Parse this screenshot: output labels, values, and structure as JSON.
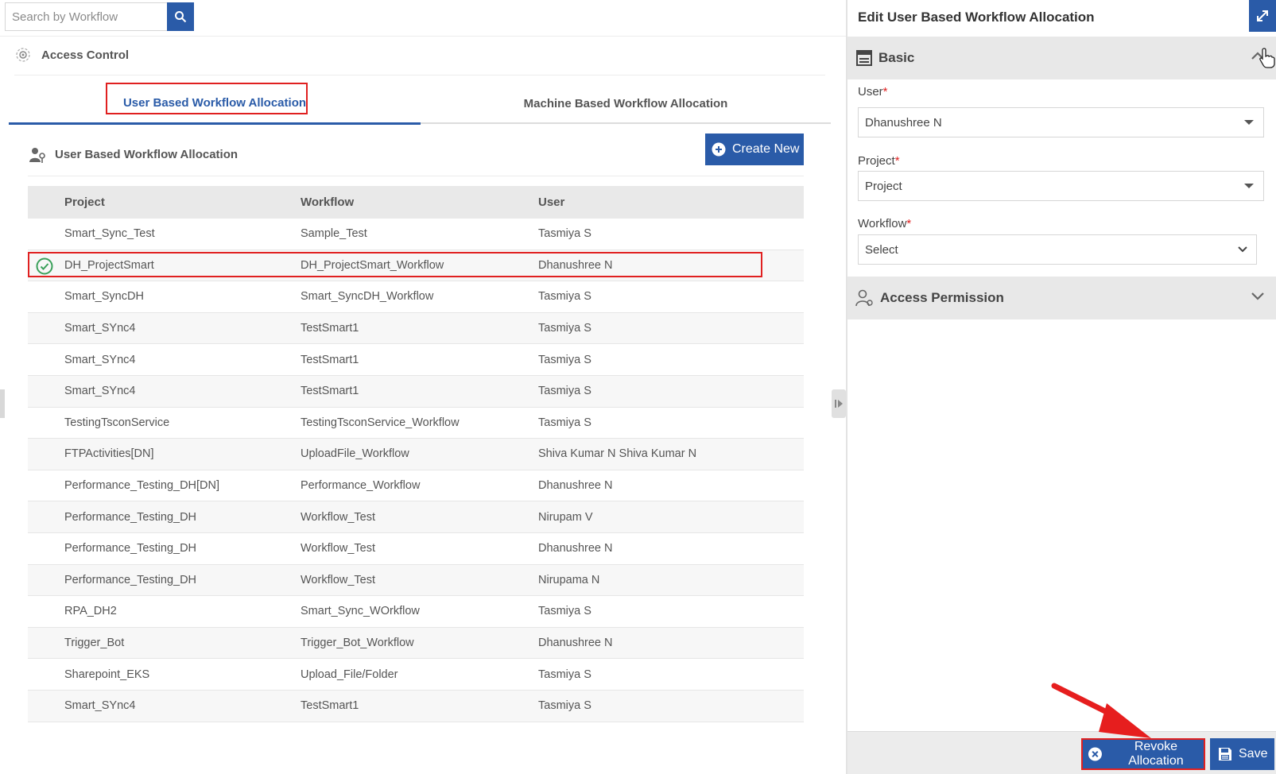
{
  "search": {
    "placeholder": "Search by Workflow"
  },
  "breadcrumb": {
    "label": "Access Control"
  },
  "tabs": [
    {
      "label": "User Based Workflow Allocation",
      "active": true
    },
    {
      "label": "Machine Based Workflow Allocation",
      "active": false
    }
  ],
  "section": {
    "title": "User Based Workflow Allocation",
    "create_label": "Create New"
  },
  "table": {
    "headers": [
      "Project",
      "Workflow",
      "User"
    ],
    "rows": [
      [
        "Smart_Sync_Test",
        "Sample_Test",
        "Tasmiya S"
      ],
      [
        "DH_ProjectSmart",
        "DH_ProjectSmart_Workflow",
        "Dhanushree N"
      ],
      [
        "Smart_SyncDH",
        "Smart_SyncDH_Workflow",
        "Tasmiya S"
      ],
      [
        "Smart_SYnc4",
        "TestSmart1",
        "Tasmiya S"
      ],
      [
        "Smart_SYnc4",
        "TestSmart1",
        "Tasmiya S"
      ],
      [
        "Smart_SYnc4",
        "TestSmart1",
        "Tasmiya S"
      ],
      [
        "TestingTsconService",
        "TestingTsconService_Workflow",
        "Tasmiya S"
      ],
      [
        "FTPActivities[DN]",
        "UploadFile_Workflow",
        "Shiva Kumar N Shiva Kumar N"
      ],
      [
        "Performance_Testing_DH[DN]",
        "Performance_Workflow",
        "Dhanushree N"
      ],
      [
        "Performance_Testing_DH",
        "Workflow_Test",
        "Nirupam V"
      ],
      [
        "Performance_Testing_DH",
        "Workflow_Test",
        "Dhanushree N"
      ],
      [
        "Performance_Testing_DH",
        "Workflow_Test",
        "Nirupama N"
      ],
      [
        "RPA_DH2",
        "Smart_Sync_WOrkflow",
        "Tasmiya S"
      ],
      [
        "Trigger_Bot",
        "Trigger_Bot_Workflow",
        "Dhanushree N"
      ],
      [
        "Sharepoint_EKS",
        "Upload_File/Folder",
        "Tasmiya S"
      ],
      [
        "Smart_SYnc4",
        "TestSmart1",
        "Tasmiya S"
      ]
    ],
    "selected_row": 1
  },
  "panel": {
    "title": "Edit User Based Workflow Allocation",
    "basic_label": "Basic",
    "user_label": "User",
    "user_value": "Dhanushree N",
    "project_label": "Project",
    "project_value": "Project",
    "workflow_label": "Workflow",
    "workflow_value": "Select",
    "required_mark": "*",
    "access_label": "Access Permission",
    "revoke_label": "Revoke Allocation",
    "save_label": "Save"
  },
  "colors": {
    "accent": "#2a5ba8",
    "highlight": "#e02020",
    "check": "#3aa05a"
  }
}
